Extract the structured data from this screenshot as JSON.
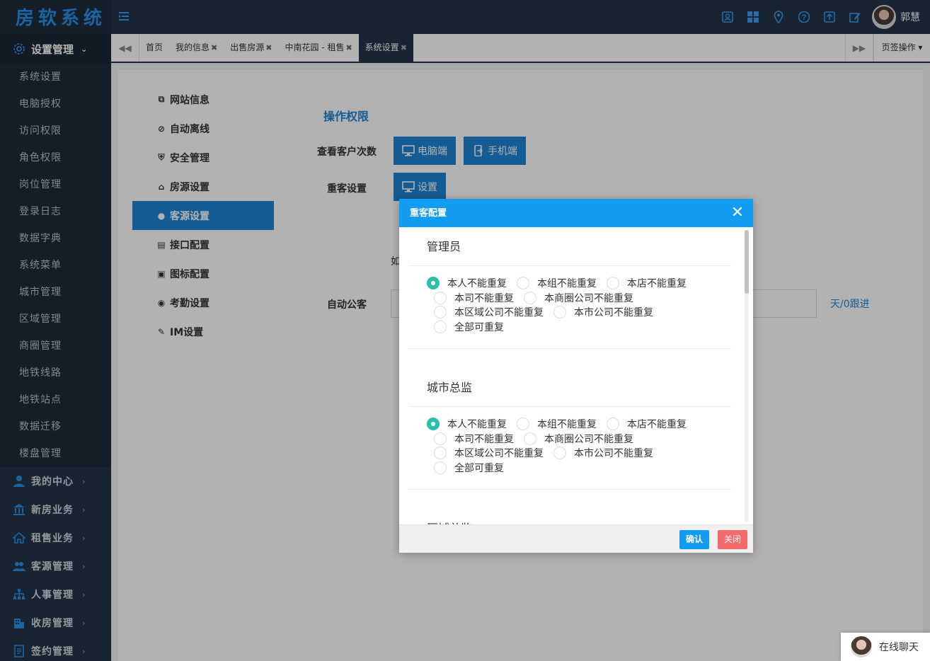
{
  "app": {
    "title": "房软系统",
    "user_name": "郭慧"
  },
  "top_icons": [
    "contacts-icon",
    "grid-icon",
    "location-icon",
    "help-icon",
    "upload-icon",
    "edit-icon"
  ],
  "sidebar": {
    "active_group": "设置管理",
    "submenu": [
      "系统设置",
      "电脑授权",
      "访问权限",
      "角色权限",
      "岗位管理",
      "登录日志",
      "数据字典",
      "系统菜单",
      "城市管理",
      "区域管理",
      "商圈管理",
      "地铁线路",
      "地铁站点",
      "数据迁移",
      "楼盘管理"
    ],
    "groups": [
      "我的中心",
      "新房业务",
      "租售业务",
      "客源管理",
      "人事管理",
      "收房管理",
      "签约管理"
    ]
  },
  "tabs": {
    "items": [
      "首页",
      "我的信息",
      "出售房源",
      "中南花园 - 租售",
      "系统设置"
    ],
    "ops_label": "页签操作"
  },
  "settings_nav": [
    "网站信息",
    "自动离线",
    "安全管理",
    "房源设置",
    "客源设置",
    "接口配置",
    "图标配置",
    "考勤设置",
    "IM设置"
  ],
  "panel": {
    "title": "操作权限",
    "view_count_label": "查看客户次数",
    "pc_button": "电脑端",
    "mobile_button": "手机端",
    "dup_label": "重客设置",
    "dup_button": "设置",
    "hint_prefix": "如",
    "auto_label": "自动公客",
    "auto_unit": "天/0跟进"
  },
  "modal": {
    "title": "重客配置",
    "roles": [
      {
        "name": "管理员",
        "selected": "本人不能重复"
      },
      {
        "name": "城市总监",
        "selected": "本人不能重复"
      },
      {
        "name": "区域总监",
        "selected": ""
      }
    ],
    "options": [
      "本人不能重复",
      "本组不能重复",
      "本店不能重复",
      "本司不能重复",
      "本商圈公司不能重复",
      "本区域公司不能重复",
      "本市公司不能重复",
      "全部可重复"
    ],
    "ok_label": "确认",
    "cancel_label": "关闭"
  },
  "chat": {
    "label": "在线聊天"
  },
  "colors": {
    "primary": "#1e85d3",
    "header": "#243448",
    "modal_header": "#129cf2",
    "radio_on": "#2bbfb0",
    "cancel": "#f36b6b"
  }
}
